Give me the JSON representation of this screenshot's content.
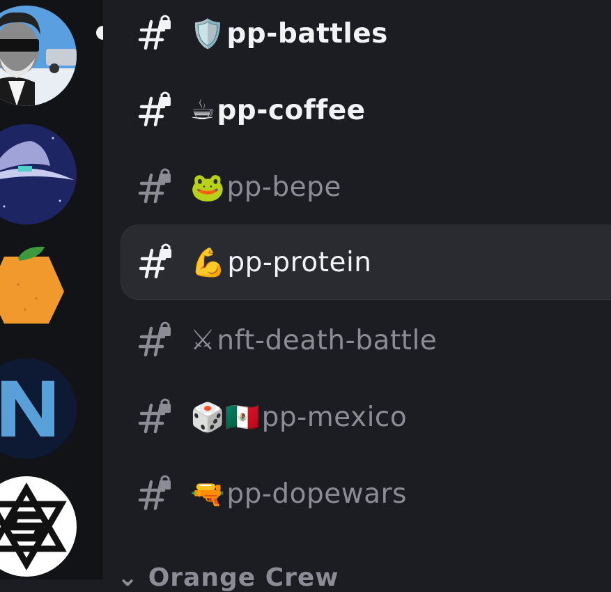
{
  "servers": [
    {
      "name": "avatar-sunglasses-man-icon"
    },
    {
      "name": "avatar-wizard-hat-icon"
    },
    {
      "name": "avatar-orange-icon"
    },
    {
      "name": "avatar-n-logo-icon"
    },
    {
      "name": "avatar-star-s-logo-icon"
    }
  ],
  "channels": [
    {
      "emoji": "🛡️",
      "name": "pp-battles",
      "state": "unread"
    },
    {
      "emoji": "☕",
      "name": "pp-coffee",
      "state": "unread"
    },
    {
      "emoji": "🐸",
      "name": "pp-bepe",
      "state": "muted"
    },
    {
      "emoji": "💪",
      "name": "pp-protein",
      "state": "selected"
    },
    {
      "emoji": "⚔",
      "name": "nft-death-battle",
      "state": "muted"
    },
    {
      "emoji": "🎲🇲🇽",
      "name": "pp-mexico",
      "state": "muted"
    },
    {
      "emoji": "🔫",
      "name": "pp-dopewars",
      "state": "muted"
    }
  ],
  "category": {
    "label": "Orange Crew"
  },
  "colors": {
    "rail_bg": "#121316",
    "list_bg": "#1c1d22",
    "selected_bg": "#2a2b31",
    "text_bright": "#f2f3f5",
    "text_muted": "#8a8d96"
  }
}
